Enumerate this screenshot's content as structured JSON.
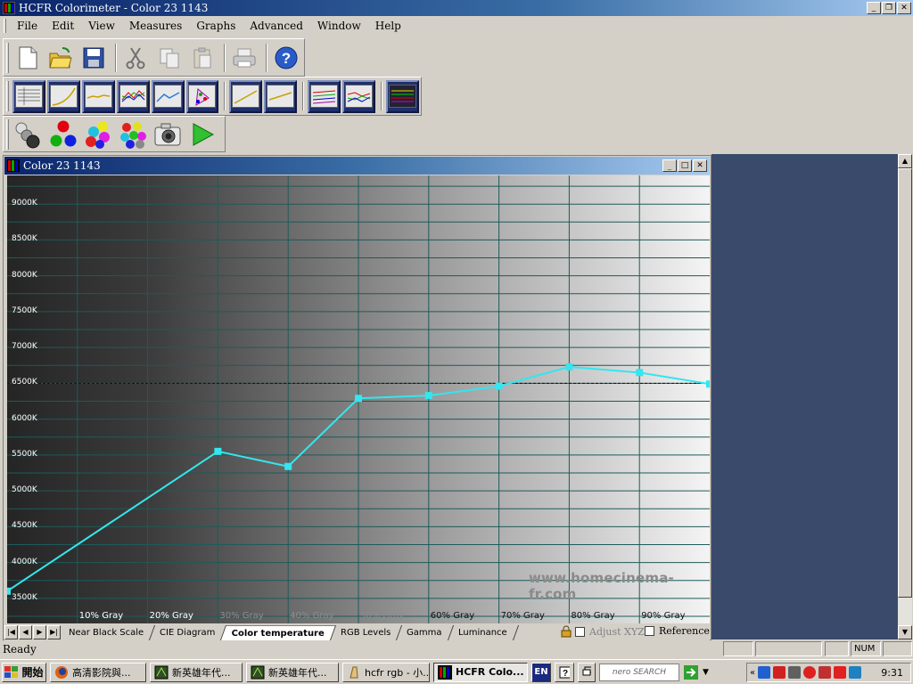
{
  "app": {
    "title": "HCFR Colorimeter - Color 23  1143",
    "menus": [
      "File",
      "Edit",
      "View",
      "Measures",
      "Graphs",
      "Advanced",
      "Window",
      "Help"
    ]
  },
  "child_window": {
    "title": "Color 23  1143"
  },
  "chart_data": {
    "type": "line",
    "title": "",
    "y_tick_labels": [
      "3500K",
      "4000K",
      "4500K",
      "5000K",
      "5500K",
      "6000K",
      "6500K",
      "7000K",
      "7500K",
      "8000K",
      "8500K",
      "9000K"
    ],
    "x_tick_labels": [
      "10% Gray",
      "20% Gray",
      "30% Gray",
      "40% Gray",
      "50% Gray",
      "60% Gray",
      "70% Gray",
      "80% Gray",
      "90% Gray"
    ],
    "ylim": [
      3150,
      9400
    ],
    "xlim": [
      0,
      100
    ],
    "reference_line": 6500,
    "series": [
      {
        "color": "#33e6ef",
        "x": [
          0,
          30,
          40,
          50,
          60,
          70,
          80,
          90,
          100
        ],
        "y": [
          3600,
          5550,
          5340,
          6290,
          6330,
          6460,
          6730,
          6650,
          6490
        ]
      }
    ],
    "watermark": "www.homecinema-fr.com",
    "grid": true
  },
  "tabs": [
    "Near Black Scale",
    "CIE Diagram",
    "Color temperature",
    "RGB Levels",
    "Gamma",
    "Luminance"
  ],
  "active_tab": "Color temperature",
  "checkboxes": {
    "adjust_xyz": "Adjust XYZ",
    "reference": "Reference"
  },
  "status": {
    "text": "Ready",
    "num": "NUM"
  },
  "taskbar": {
    "start": "開始",
    "tasks": [
      "高清影院與...",
      "新英雄年代...",
      "新英雄年代...",
      "hcfr rgb - 小...",
      "HCFR Colo..."
    ],
    "lang": "EN",
    "search": "nero SEARCH",
    "clock": "9:31"
  },
  "colors": {
    "series": "#33e6ef",
    "grid": "#1f5a5a",
    "titlebar": "#0a246a"
  }
}
